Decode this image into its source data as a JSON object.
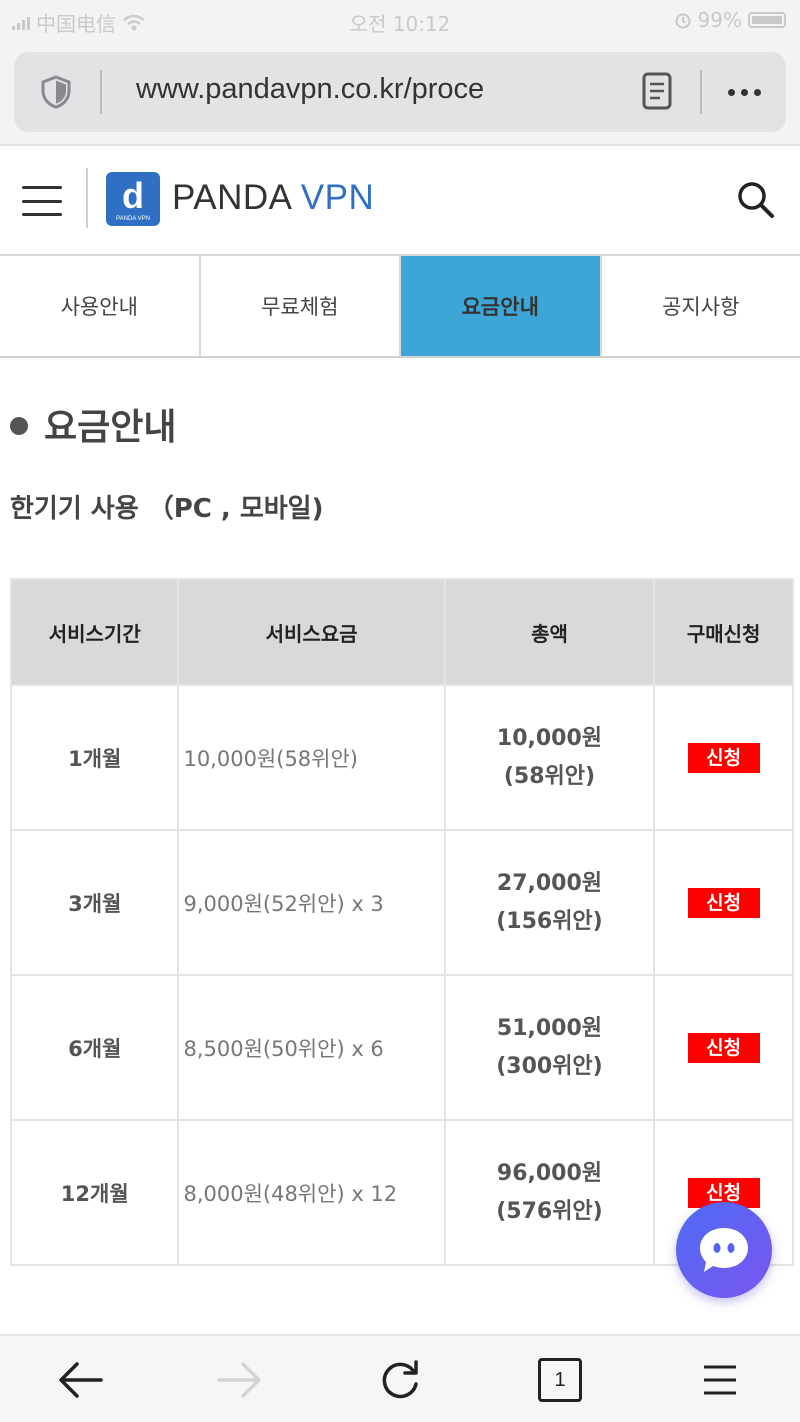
{
  "status_bar": {
    "carrier": "中国电信",
    "time": "오전 10:12",
    "battery": "99%"
  },
  "browser": {
    "url": "www.pandavpn.co.kr/proce",
    "tab_count": "1"
  },
  "header": {
    "brand_part1": "PANDA",
    "brand_part2": "VPN",
    "logo_letter": "d",
    "logo_caption": "PANDA VPN",
    "brand_color": "#2f6fc4"
  },
  "tabs": [
    {
      "label": "사용안내",
      "active": false
    },
    {
      "label": "무료체험",
      "active": false
    },
    {
      "label": "요금안내",
      "active": true
    },
    {
      "label": "공지사항",
      "active": false
    }
  ],
  "main": {
    "title": "요금안내",
    "subtitle": "한기기 사용 （PC , 모바일)"
  },
  "table": {
    "headers": [
      "서비스기간",
      "서비스요금",
      "총액",
      "구매신청"
    ],
    "rows": [
      {
        "period": "1개월",
        "fee": "10,000원(58위안)",
        "total_krw": "10,000원",
        "total_cny": "(58위안)",
        "action": "신청"
      },
      {
        "period": "3개월",
        "fee": "9,000원(52위안) x 3",
        "total_krw": "27,000원",
        "total_cny": "(156위안)",
        "action": "신청"
      },
      {
        "period": "6개월",
        "fee": "8,500원(50위안) x 6",
        "total_krw": "51,000원",
        "total_cny": "(300위안)",
        "action": "신청"
      },
      {
        "period": "12개월",
        "fee": "8,000원(48위안) x 12",
        "total_krw": "96,000원",
        "total_cny": "(576위안)",
        "action": "신청"
      }
    ]
  },
  "colors": {
    "active_tab": "#3ea6d6",
    "apply_button": "#ff0000",
    "chat_gradient_start": "#4e6cf4",
    "chat_gradient_end": "#7a55f0"
  },
  "icons": {
    "url_left": "shield-icon",
    "url_reader": "reader-mode-icon",
    "url_more": "more-dots-icon",
    "header_menu": "hamburger-menu-icon",
    "header_search": "search-icon",
    "chat": "chat-bubble-icon",
    "back": "back-arrow-icon",
    "forward": "forward-arrow-icon",
    "reload": "reload-icon",
    "tabs": "tab-switcher-icon",
    "menu": "browser-menu-icon"
  }
}
